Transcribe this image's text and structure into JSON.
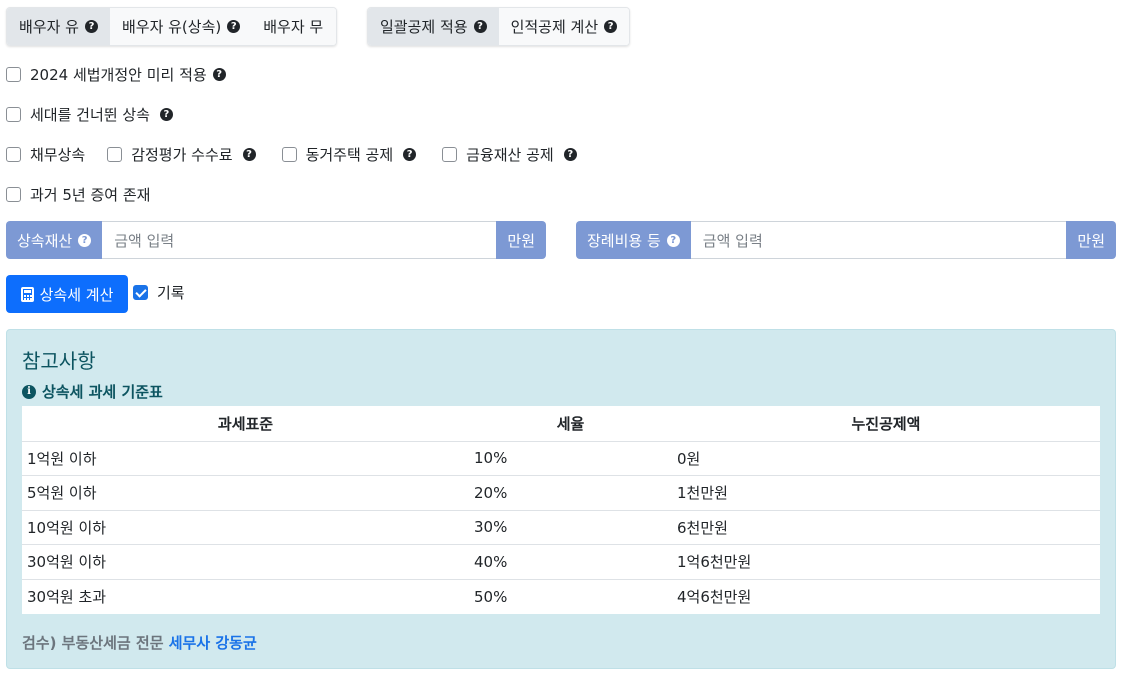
{
  "spouse_tabs": [
    {
      "label": "배우자 유",
      "help": "?",
      "active": true
    },
    {
      "label": "배우자 유(상속)",
      "help": "?",
      "active": false
    },
    {
      "label": "배우자 무",
      "help": "",
      "active": false
    }
  ],
  "deduction_tabs": [
    {
      "label": "일괄공제 적용",
      "help": "?",
      "active": true
    },
    {
      "label": "인적공제 계산",
      "help": "?",
      "active": false
    }
  ],
  "options": {
    "law_2024": {
      "label": "2024 세법개정안 미리 적용",
      "checked": false
    },
    "generation_skip": {
      "label": "세대를 건너뛴 상속",
      "checked": false
    },
    "debt": {
      "label": "채무상속",
      "checked": false
    },
    "appraisal_fee": {
      "label": "감정평가 수수료",
      "checked": false
    },
    "cohabiting_house": {
      "label": "동거주택 공제",
      "checked": false
    },
    "financial_assets": {
      "label": "금융재산 공제",
      "checked": false
    },
    "prior_gift": {
      "label": "과거 5년 증여 존재",
      "checked": false
    }
  },
  "inputs": {
    "estate": {
      "label": "상속재산",
      "placeholder": "금액 입력",
      "unit": "만원"
    },
    "funeral": {
      "label": "장례비용 등",
      "placeholder": "금액 입력",
      "unit": "만원"
    }
  },
  "actions": {
    "calculate": "상속세 계산",
    "record_label": "기록",
    "record_checked": true
  },
  "reference": {
    "title": "참고사항",
    "table_title": "상속세 과세 기준표",
    "info_icon": "i",
    "headers": [
      "과세표준",
      "세율",
      "누진공제액"
    ],
    "rows": [
      [
        "1억원 이하",
        "10%",
        "0원"
      ],
      [
        "5억원 이하",
        "20%",
        "1천만원"
      ],
      [
        "10억원 이하",
        "30%",
        "6천만원"
      ],
      [
        "30억원 이하",
        "40%",
        "1억6천만원"
      ],
      [
        "30억원 초과",
        "50%",
        "4억6천만원"
      ]
    ],
    "footer_prefix": "검수) 부동산세금 전문",
    "footer_link": "세무사 강동균"
  }
}
